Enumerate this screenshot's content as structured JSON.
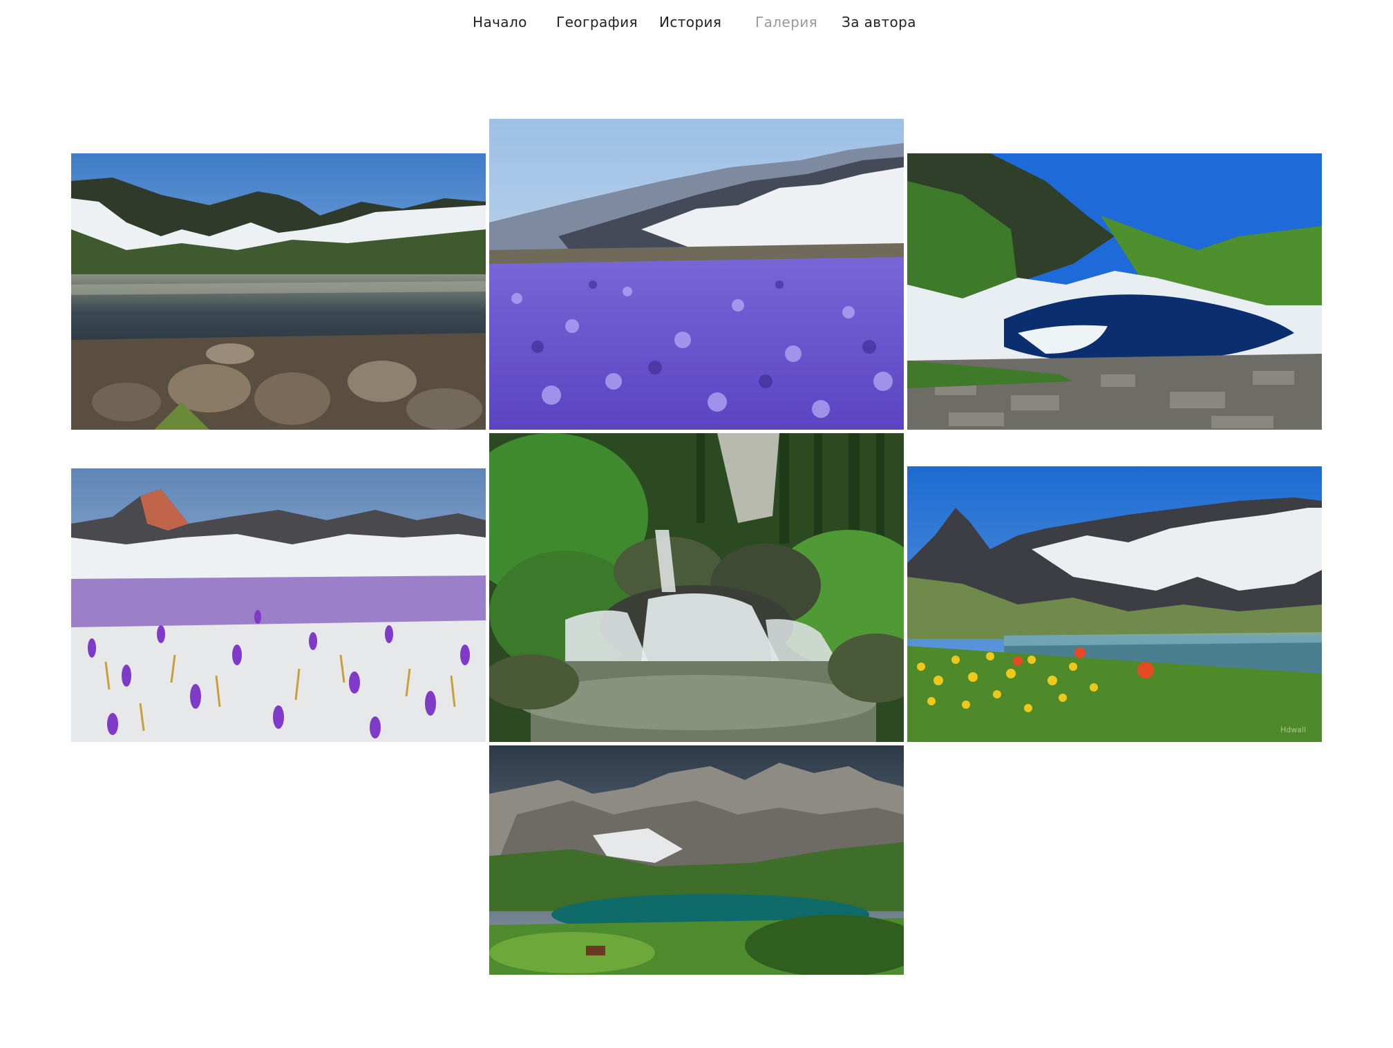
{
  "nav": {
    "items": [
      {
        "label": "Начало",
        "active": false
      },
      {
        "label": "География",
        "active": false
      },
      {
        "label": "История",
        "active": false
      },
      {
        "label": "Галерия",
        "active": true
      },
      {
        "label": "За автора",
        "active": false
      }
    ]
  },
  "colors": {
    "nav_text": "#222222",
    "nav_active": "#9a9a9a",
    "background": "#ffffff"
  },
  "gallery": {
    "photos": [
      {
        "name": "lake-with-rocks-photo"
      },
      {
        "name": "crocus-meadow-photo"
      },
      {
        "name": "glacial-lake-photo"
      },
      {
        "name": "snow-crocus-field-photo"
      },
      {
        "name": "forest-waterfall-photo"
      },
      {
        "name": "lake-with-wildflowers-photo",
        "watermark": "Hdwall"
      },
      {
        "name": "green-lake-cliffs-photo"
      }
    ]
  }
}
